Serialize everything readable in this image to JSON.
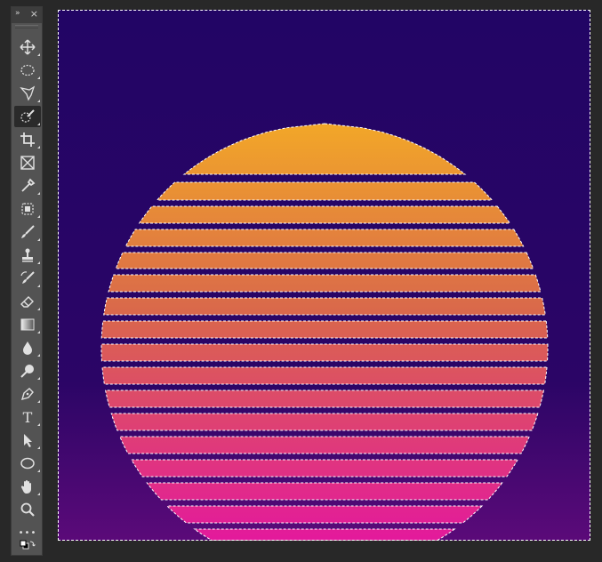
{
  "toolbar": {
    "collapse_label": "»",
    "close_label": "×",
    "tools": [
      {
        "name": "move-tool",
        "icon": "move-icon"
      },
      {
        "name": "elliptical-marquee-tool",
        "icon": "ellipse-marquee-icon"
      },
      {
        "name": "polygonal-lasso-tool",
        "icon": "lasso-icon"
      },
      {
        "name": "quick-selection-tool",
        "icon": "quick-selection-icon",
        "active": true
      },
      {
        "name": "crop-tool",
        "icon": "crop-icon"
      },
      {
        "name": "frame-tool",
        "icon": "frame-icon"
      },
      {
        "name": "eyedropper-tool",
        "icon": "eyedropper-icon"
      },
      {
        "name": "spot-healing-tool",
        "icon": "healing-icon"
      },
      {
        "name": "brush-tool",
        "icon": "brush-icon"
      },
      {
        "name": "clone-stamp-tool",
        "icon": "stamp-icon"
      },
      {
        "name": "history-brush-tool",
        "icon": "history-brush-icon"
      },
      {
        "name": "eraser-tool",
        "icon": "eraser-icon"
      },
      {
        "name": "gradient-tool",
        "icon": "gradient-icon"
      },
      {
        "name": "blur-tool",
        "icon": "drop-icon"
      },
      {
        "name": "dodge-tool",
        "icon": "dodge-icon"
      },
      {
        "name": "pen-tool",
        "icon": "pen-icon"
      },
      {
        "name": "type-tool",
        "icon": "type-icon",
        "label": "T"
      },
      {
        "name": "path-selection-tool",
        "icon": "arrow-icon"
      },
      {
        "name": "ellipse-tool",
        "icon": "ellipse-icon"
      },
      {
        "name": "hand-tool",
        "icon": "hand-icon"
      },
      {
        "name": "zoom-tool",
        "icon": "zoom-icon"
      },
      {
        "name": "edit-toolbar",
        "icon": "more-icon",
        "label": "•••"
      },
      {
        "name": "color-swatches",
        "icon": "swatch-icon"
      }
    ]
  },
  "canvas": {
    "colors": {
      "sky_top": "#220565",
      "sky_mid": "#2b0566",
      "sky_bottom": "#5b0a79",
      "sun_top": "#f2a728",
      "sun_mid": "#d9684b",
      "sun_bottom": "#e3199c",
      "selection": "#ffffff"
    }
  }
}
